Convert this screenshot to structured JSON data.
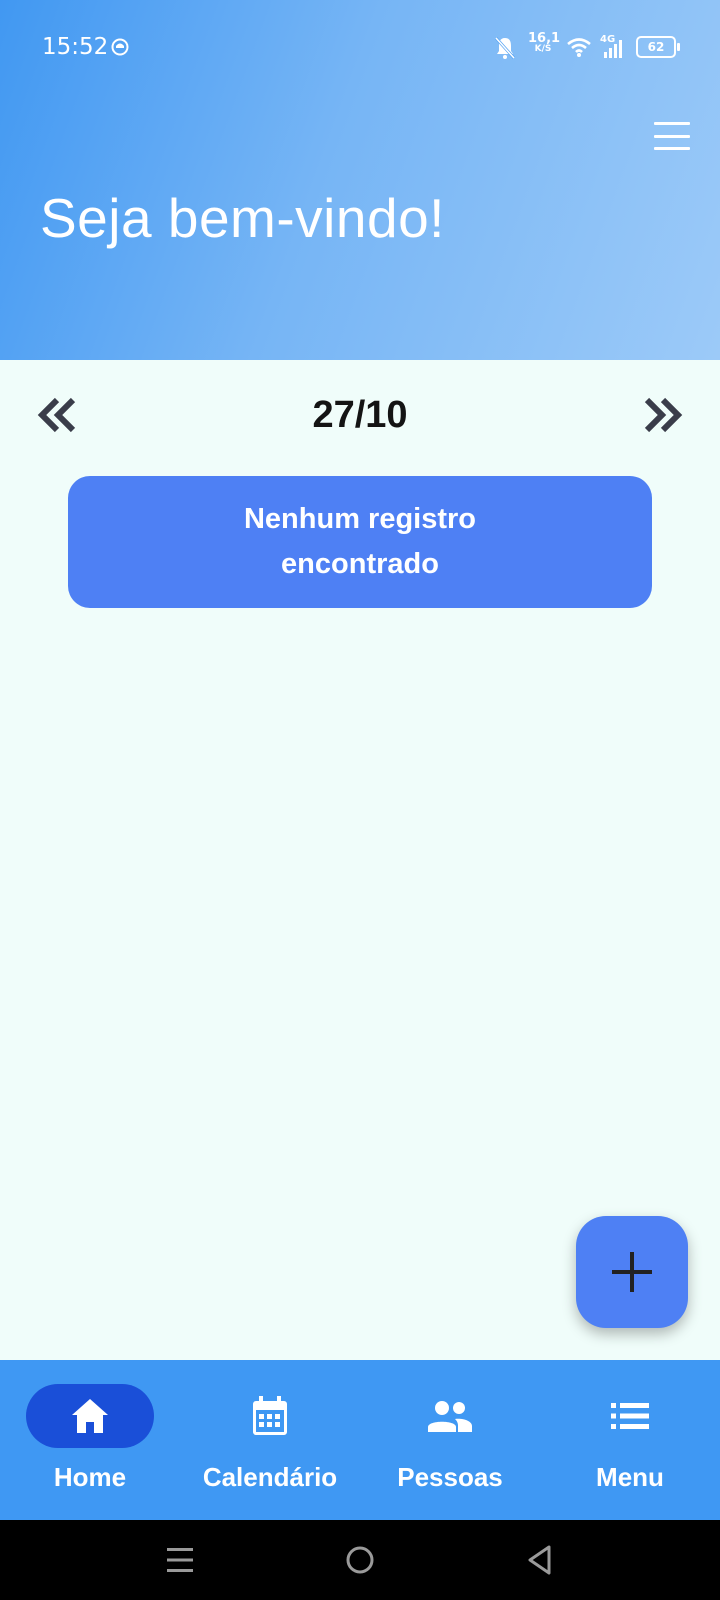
{
  "status_bar": {
    "time": "15:52",
    "net_speed": "16,1",
    "net_speed_unit": "K/S",
    "network_type": "4G",
    "battery": "62"
  },
  "header": {
    "welcome": "Seja bem-vindo!",
    "menu_icon": "hamburger-icon"
  },
  "date_nav": {
    "date": "27/10",
    "prev_icon": "double-chevron-left-icon",
    "next_icon": "double-chevron-right-icon"
  },
  "empty_state": {
    "message": "Nenhum registro encontrado"
  },
  "fab": {
    "icon": "plus-icon"
  },
  "bottom_nav": {
    "items": [
      {
        "label": "Home",
        "icon": "home-icon",
        "active": true
      },
      {
        "label": "Calendário",
        "icon": "calendar-icon",
        "active": false
      },
      {
        "label": "Pessoas",
        "icon": "people-icon",
        "active": false
      },
      {
        "label": "Menu",
        "icon": "list-icon",
        "active": false
      }
    ]
  },
  "colors": {
    "header_gradient_start": "#4198f2",
    "header_gradient_end": "#9ccaf8",
    "background": "#f0fdfa",
    "card": "#4e80f4",
    "bottom_nav": "#3f98f3",
    "nav_active_pill": "#1a4fd8"
  }
}
